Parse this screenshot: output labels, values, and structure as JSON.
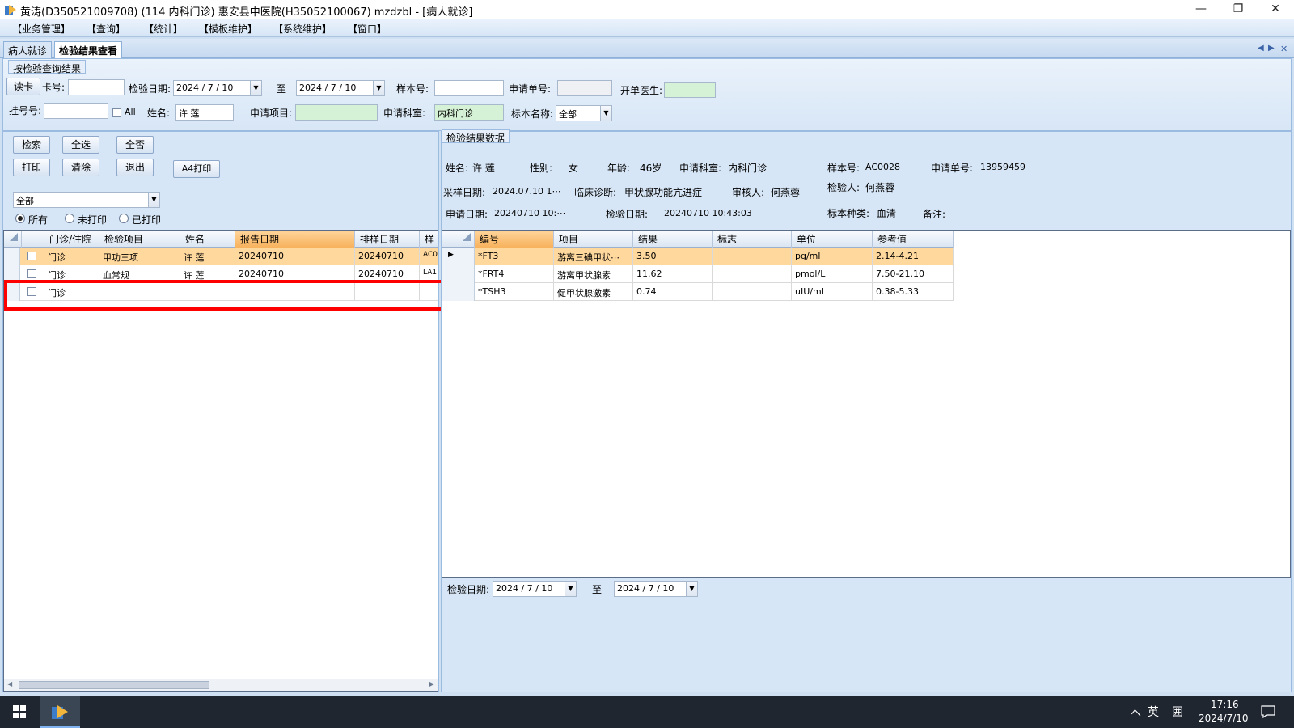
{
  "window": {
    "title": "黄涛(D350521009708) (114 内科门诊) 惠安县中医院(H35052100067) mzdzbl - [病人就诊]",
    "controls": [
      "—",
      "❐",
      "✕"
    ]
  },
  "menu": [
    "【业务管理】",
    "【查询】",
    "【统计】",
    "【模板维护】",
    "【系统维护】",
    "【窗口】"
  ],
  "tabs": [
    "病人就诊",
    "检验结果查看"
  ],
  "tab_controls": [
    "◀",
    "▶",
    "✕"
  ],
  "query": {
    "group_title": "按检验查询结果",
    "read_card_btn": "读卡",
    "card_label": "卡号:",
    "card_value": "",
    "date_label": "检验日期:",
    "date_from": "2024 / 7 / 10",
    "to_label": "至",
    "date_to": "2024 / 7 / 10",
    "sample_label": "样本号:",
    "sample_value": "",
    "apply_no_label": "申请单号:",
    "apply_no_value": "",
    "doctor_label": "开单医生:",
    "doctor_value": "",
    "reg_label": "挂号号:",
    "reg_value": "",
    "all_label": "All",
    "name_label": "姓名:",
    "name_value": "许  莲",
    "item_label": "申请项目:",
    "item_value": "",
    "dept_label": "申请科室:",
    "dept_value": "内科门诊",
    "specimen_label": "标本名称:",
    "specimen_value": "全部"
  },
  "left": {
    "buttons": {
      "search": "检索",
      "select_all": "全选",
      "select_none": "全否",
      "print": "打印",
      "clear": "清除",
      "exit": "退出",
      "a4_print": "A4打印"
    },
    "filter_value": "全部",
    "radios": [
      "所有",
      "未打印",
      "已打印"
    ],
    "radio_selected": 0,
    "columns": [
      "门诊/住院",
      "检验项目",
      "姓名",
      "报告日期",
      "排样日期",
      "样"
    ],
    "rows": [
      {
        "type": "门诊",
        "item": "甲功三项",
        "name": "许  莲",
        "report_date": "20240710",
        "sample_date": "20240710",
        "sample": "AC0"
      },
      {
        "type": "门诊",
        "item": "血常规",
        "name": "许  莲",
        "report_date": "20240710",
        "sample_date": "20240710",
        "sample": "LA1"
      },
      {
        "type": "门诊",
        "item": "",
        "name": "",
        "report_date": "",
        "sample_date": "",
        "sample": ""
      }
    ]
  },
  "right": {
    "group_title": "检验结果数据",
    "info": {
      "name_label": "姓名:",
      "name": "许  莲",
      "sex_label": "性别:",
      "sex": "女",
      "age_label": "年龄:",
      "age": "46岁",
      "dept_label": "申请科室:",
      "dept": "内科门诊",
      "sample_label": "样本号:",
      "sample": "AC0028",
      "apply_label": "申请单号:",
      "apply": "13959459",
      "collect_label": "采样日期:",
      "collect": "2024.07.10 1⋯",
      "diag_label": "临床诊断:",
      "diag": "甲状腺功能亢进症",
      "reviewer_label": "审核人:",
      "reviewer": "何燕蓉",
      "tester_label": "检验人:",
      "tester": "何燕蓉",
      "apply_date_label": "申请日期:",
      "apply_date": "20240710 10:⋯",
      "test_date_label": "检验日期:",
      "test_date": "20240710 10:43:03",
      "specimen_label": "标本种类:",
      "specimen": "血清",
      "note_label": "备注:",
      "note": ""
    },
    "columns": [
      "编号",
      "项目",
      "结果",
      "标志",
      "单位",
      "参考值"
    ],
    "rows": [
      {
        "code": "*FT3",
        "item": "游离三碘甲状⋯",
        "result": "3.50",
        "flag": "",
        "unit": "pg/ml",
        "ref": "2.14-4.21"
      },
      {
        "code": "*FRT4",
        "item": "游离甲状腺素",
        "result": "11.62",
        "flag": "",
        "unit": "pmol/L",
        "ref": "7.50-21.10"
      },
      {
        "code": "*TSH3",
        "item": "促甲状腺激素",
        "result": "0.74",
        "flag": "",
        "unit": "uIU/mL",
        "ref": "0.38-5.33"
      }
    ],
    "bottom": {
      "date_label": "检验日期:",
      "date_from": "2024 / 7 / 10",
      "to_label": "至",
      "date_to": "2024 / 7 / 10"
    }
  },
  "taskbar": {
    "tray_chevron": "ヘ",
    "lang": "英",
    "ime": "囲",
    "time": "17:16",
    "date": "2024/7/10"
  }
}
